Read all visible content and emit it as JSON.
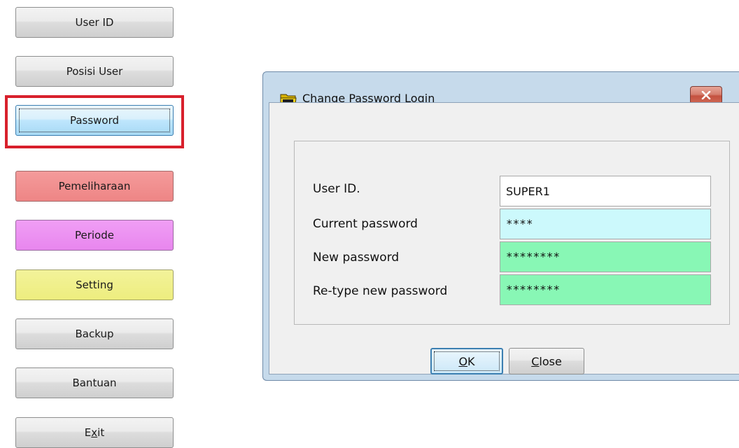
{
  "menu": {
    "user_id": "User ID",
    "posisi_user": "Posisi User",
    "password": "Password",
    "pemeliharaan": "Pemeliharaan",
    "periode": "Periode",
    "setting": "Setting",
    "backup": "Backup",
    "bantuan": "Bantuan",
    "exit_before": "E",
    "exit_mnemonic": "x",
    "exit_after": "it"
  },
  "dialog": {
    "title": "Change Password Login",
    "icon": "folder-icon",
    "close_icon": "close-icon",
    "fields": {
      "user_id_label": "User ID.",
      "user_id_value": "SUPER1",
      "current_label": "Current password",
      "current_value": "****",
      "new_label": "New password",
      "new_value": "********",
      "retype_label": "Re-type new password",
      "retype_value": "********"
    },
    "ok_mnemonic": "O",
    "ok_rest": "K",
    "close_mnemonic": "C",
    "close_rest": "lose"
  },
  "colors": {
    "highlight": "#d8202c",
    "current_field_bg": "#ccf9fc",
    "new_field_bg": "#88f7b5",
    "pemeliharaan_bg": "#f09191",
    "periode_bg": "#ec93f2",
    "setting_bg": "#f1f18c"
  }
}
